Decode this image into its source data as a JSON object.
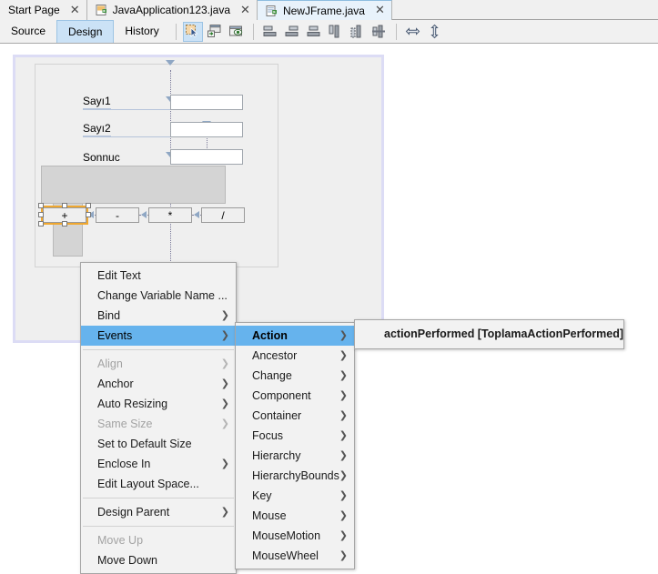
{
  "editor_tabs": [
    {
      "label": "Start Page",
      "icon": "",
      "active": false,
      "closable": true
    },
    {
      "label": "JavaApplication123.java",
      "icon": "java-file-icon",
      "active": false,
      "closable": true
    },
    {
      "label": "NewJFrame.java",
      "icon": "jframe-file-icon",
      "active": true,
      "closable": true
    }
  ],
  "view_tabs": [
    {
      "label": "Source",
      "selected": false
    },
    {
      "label": "Design",
      "selected": true
    },
    {
      "label": "History",
      "selected": false
    }
  ],
  "toolbar": {
    "buttons": [
      {
        "name": "selection-mode-icon",
        "active": true
      },
      {
        "name": "connection-mode-icon",
        "active": false
      },
      {
        "name": "preview-design-icon",
        "active": false
      },
      {
        "name": "align-left-icon",
        "active": false
      },
      {
        "name": "align-right-icon",
        "active": false
      },
      {
        "name": "align-center-horizontal-icon",
        "active": false
      },
      {
        "name": "align-top-icon",
        "active": false
      },
      {
        "name": "align-bottom-icon",
        "active": false
      },
      {
        "name": "align-center-vertical-icon",
        "active": false
      },
      {
        "name": "resize-horizontal-icon",
        "active": false
      },
      {
        "name": "resize-vertical-icon",
        "active": false
      }
    ]
  },
  "form": {
    "labels": [
      {
        "text": "Sayı1"
      },
      {
        "text": "Sayı2"
      },
      {
        "text": "Sonnuc"
      }
    ],
    "text_fields": [
      {
        "value": ""
      },
      {
        "value": ""
      },
      {
        "value": ""
      }
    ],
    "buttons": [
      {
        "label": "+",
        "selected": true
      },
      {
        "label": "-",
        "selected": false
      },
      {
        "label": "*",
        "selected": false
      },
      {
        "label": "/",
        "selected": false
      }
    ]
  },
  "context_menu": {
    "items": [
      {
        "label": "Edit Text",
        "submenu": false,
        "disabled": false,
        "selected": false
      },
      {
        "label": "Change Variable Name ...",
        "submenu": false,
        "disabled": false,
        "selected": false
      },
      {
        "label": "Bind",
        "submenu": true,
        "disabled": false,
        "selected": false
      },
      {
        "label": "Events",
        "submenu": true,
        "disabled": false,
        "selected": true
      },
      {
        "separator": true
      },
      {
        "label": "Align",
        "submenu": true,
        "disabled": true,
        "selected": false
      },
      {
        "label": "Anchor",
        "submenu": true,
        "disabled": false,
        "selected": false
      },
      {
        "label": "Auto Resizing",
        "submenu": true,
        "disabled": false,
        "selected": false
      },
      {
        "label": "Same Size",
        "submenu": true,
        "disabled": true,
        "selected": false
      },
      {
        "label": "Set to Default Size",
        "submenu": false,
        "disabled": false,
        "selected": false
      },
      {
        "label": "Enclose In",
        "submenu": true,
        "disabled": false,
        "selected": false
      },
      {
        "label": "Edit Layout Space...",
        "submenu": false,
        "disabled": false,
        "selected": false
      },
      {
        "separator": true
      },
      {
        "label": "Design Parent",
        "submenu": true,
        "disabled": false,
        "selected": false
      },
      {
        "separator": true
      },
      {
        "label": "Move Up",
        "submenu": false,
        "disabled": true,
        "selected": false
      },
      {
        "label": "Move Down",
        "submenu": false,
        "disabled": false,
        "selected": false
      }
    ]
  },
  "events_menu": {
    "items": [
      {
        "label": "Action",
        "submenu": true,
        "selected": true,
        "bold": true
      },
      {
        "label": "Ancestor",
        "submenu": true,
        "selected": false,
        "bold": false
      },
      {
        "label": "Change",
        "submenu": true,
        "selected": false,
        "bold": false
      },
      {
        "label": "Component",
        "submenu": true,
        "selected": false,
        "bold": false
      },
      {
        "label": "Container",
        "submenu": true,
        "selected": false,
        "bold": false
      },
      {
        "label": "Focus",
        "submenu": true,
        "selected": false,
        "bold": false
      },
      {
        "label": "Hierarchy",
        "submenu": true,
        "selected": false,
        "bold": false
      },
      {
        "label": "HierarchyBounds",
        "submenu": true,
        "selected": false,
        "bold": false
      },
      {
        "label": "Key",
        "submenu": true,
        "selected": false,
        "bold": false
      },
      {
        "label": "Mouse",
        "submenu": true,
        "selected": false,
        "bold": false
      },
      {
        "label": "MouseMotion",
        "submenu": true,
        "selected": false,
        "bold": false
      },
      {
        "label": "MouseWheel",
        "submenu": true,
        "selected": false,
        "bold": false
      }
    ]
  },
  "action_menu": {
    "items": [
      {
        "label": "actionPerformed [ToplamaActionPerformed]",
        "bold": true
      }
    ]
  },
  "colors": {
    "selection_highlight": "#66b3ed",
    "selection_handle_border": "#f0a830",
    "tab_active": "#e8f2fb",
    "toolbar_selected": "#cbe2f6",
    "form_border": "#dcdcf5",
    "gray_panel": "#d4d4d4"
  }
}
